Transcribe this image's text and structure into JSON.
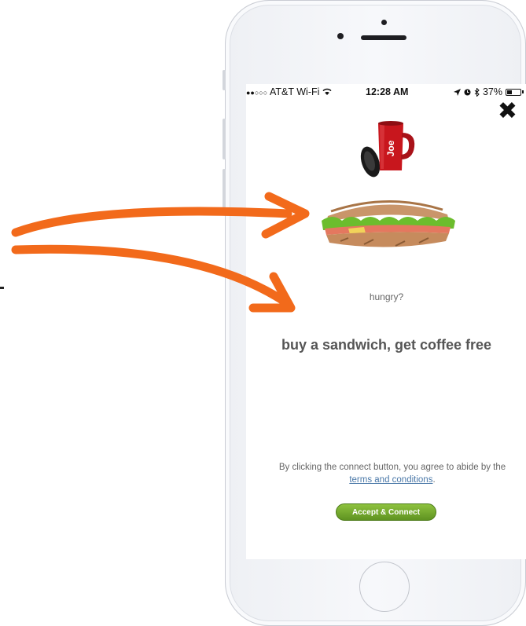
{
  "status_bar": {
    "signal": "●●○○○",
    "carrier": "AT&T Wi-Fi",
    "time": "12:28 AM",
    "battery": "37%",
    "battery_level": 0.37
  },
  "icons": {
    "close": "close-icon",
    "wifi": "wifi-icon",
    "location": "location-arrow-icon",
    "alarm": "alarm-icon",
    "bluetooth": "bluetooth-icon",
    "battery": "battery-icon"
  },
  "splash": {
    "mug_logo": "Joe",
    "tagline": "hungry?",
    "headline": "buy a sandwich, get coffee free",
    "terms_prefix": "By clicking the connect button, you agree to abide by the",
    "terms_link": "terms and conditions",
    "terms_suffix": ".",
    "accept_button": "Accept & Connect"
  },
  "colors": {
    "annotation_arrow": "#f26a1b",
    "accept_button": "#6fa12b",
    "link": "#4a78a8"
  }
}
